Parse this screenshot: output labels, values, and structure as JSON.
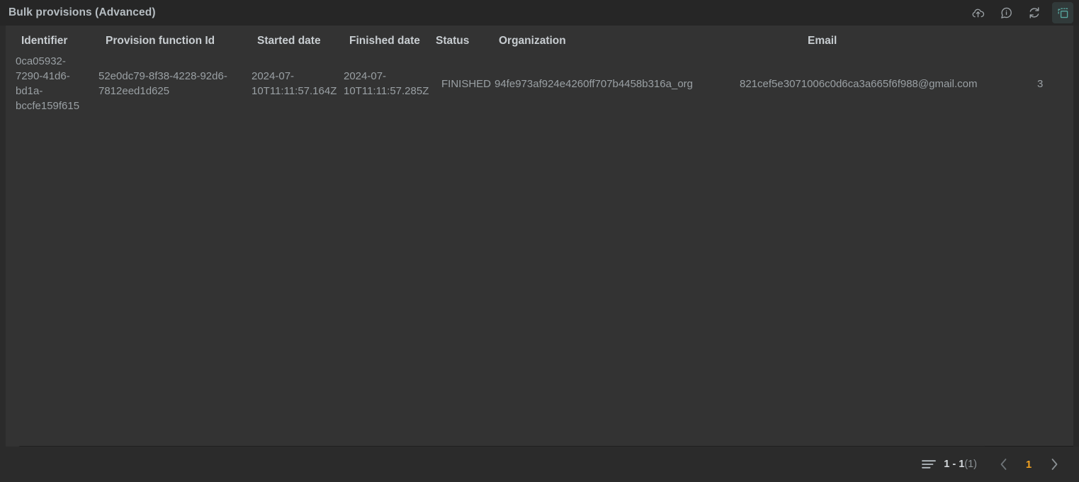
{
  "window": {
    "title": "Bulk provisions (Advanced)",
    "actions": [
      {
        "name": "cloud-upload-icon",
        "label": "Upload",
        "active": false
      },
      {
        "name": "info-icon",
        "label": "Info",
        "active": false
      },
      {
        "name": "refresh-icon",
        "label": "Refresh",
        "active": false
      },
      {
        "name": "select-area-icon",
        "label": "Select",
        "active": true
      }
    ]
  },
  "table": {
    "columns": [
      "Identifier",
      "Provision function Id",
      "Started date",
      "Finished date",
      "Status",
      "Organization",
      "Email"
    ],
    "rows": [
      {
        "identifier": "0ca05932-7290-41d6-bd1a-bccfe159f615",
        "provision_function_id": "52e0dc79-8f38-4228-92d6-7812eed1d625",
        "started_date": "2024-07-10T11:11:57.164Z",
        "finished_date": "2024-07-10T11:11:57.285Z",
        "status": "FINISHED",
        "organization": "94fe973af924e4260ff707b4458b316a_org",
        "email": "821cef5e3071006c0d6ca3a665f6f988@gmail.com",
        "overflow": "3"
      }
    ]
  },
  "pagination": {
    "range": "1 - 1",
    "total": "(1)",
    "current_page": "1",
    "prev_label": "‹",
    "next_label": "›"
  },
  "colors": {
    "accent": "#f0a020",
    "panel": "#333333",
    "titlebar": "#262626",
    "page": "#2b2b2b",
    "icon_active": "#58a8a0",
    "text_primary": "#c8cdd1",
    "text_secondary": "#9aa0a4"
  }
}
